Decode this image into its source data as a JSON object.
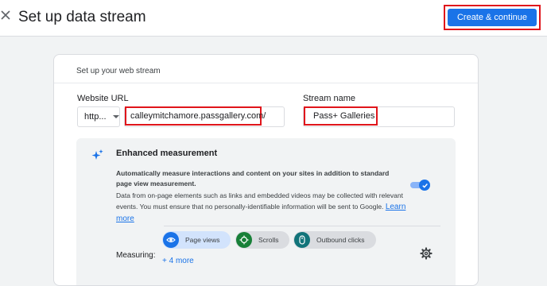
{
  "header": {
    "title": "Set up data stream",
    "create_label": "Create & continue"
  },
  "card": {
    "title": "Set up your web stream",
    "website_url_label": "Website URL",
    "protocol_value": "http...",
    "url_value": "calleymitchamore.passgallery.com/",
    "stream_name_label": "Stream name",
    "stream_name_value": "Pass+ Galleries"
  },
  "enhanced": {
    "title": "Enhanced measurement",
    "description": "Automatically measure interactions and content on your sites in addition to standard page view measurement.",
    "note": "Data from on-page elements such as links and embedded videos may be collected with relevant events. You must ensure that no personally-identifiable information will be sent to Google.",
    "learn_more": "Learn more",
    "toggle_on": true,
    "measuring_label": "Measuring:",
    "chips": [
      {
        "label": "Page views",
        "icon": "eye-icon"
      },
      {
        "label": "Scrolls",
        "icon": "crosshair-icon"
      },
      {
        "label": "Outbound clicks",
        "icon": "mouse-icon"
      }
    ],
    "more_label": "+ 4 more"
  },
  "colors": {
    "accent": "#1a73e8",
    "highlight": "#e0151b"
  }
}
